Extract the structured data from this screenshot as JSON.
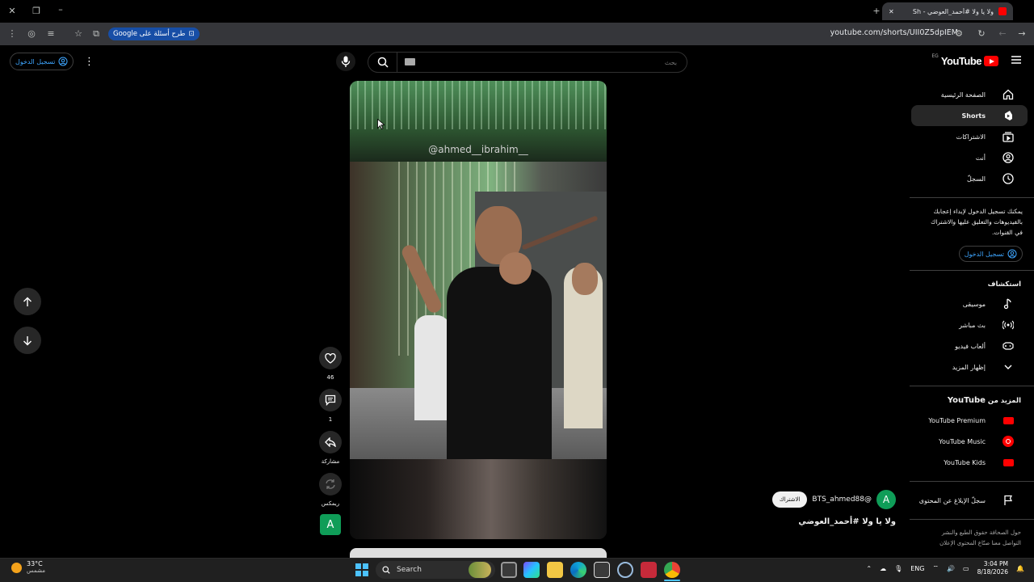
{
  "browser": {
    "tab_title": "ولا يا ولا #أحمد_العوضي - Sh",
    "url": "youtube.com/shorts/UII0Z5dpIEM",
    "google_chip": "طرح أسئلة على Google"
  },
  "header": {
    "signin": "تسجيل الدخول",
    "search_placeholder": "بحث",
    "logo_text": "YouTube",
    "country_code": "EG"
  },
  "sidebar": {
    "items": [
      {
        "label": "الصفحة الرئيسية",
        "icon": "home-icon"
      },
      {
        "label": "Shorts",
        "icon": "shorts-icon",
        "active": true
      },
      {
        "label": "الاشتراكات",
        "icon": "subscriptions-icon"
      },
      {
        "label": "أنت",
        "icon": "you-icon"
      },
      {
        "label": "السجلّ",
        "icon": "history-icon"
      }
    ],
    "signin_text": "يمكنك تسجيل الدخول لإبداء إعجابك بالفيديوهات والتعليق عليها والاشتراك في القنوات.",
    "signin_button": "تسجيل الدخول",
    "explore_title": "استكشاف",
    "explore": [
      {
        "label": "موسيقى",
        "icon": "music-icon"
      },
      {
        "label": "بث مباشر",
        "icon": "live-icon"
      },
      {
        "label": "ألعاب فيديو",
        "icon": "gaming-icon"
      },
      {
        "label": "إظهار المزيد",
        "icon": "chevron-down-icon"
      }
    ],
    "more_title_prefix": "المزيد من",
    "more_title_brand": "YouTube",
    "more": [
      {
        "label": "YouTube Premium"
      },
      {
        "label": "YouTube Music"
      },
      {
        "label": "YouTube Kids"
      }
    ],
    "report": "سجلّ الإبلاغ عن المحتوى",
    "footer_line1": "حول  الصحافة  حقوق الطبع والنشر",
    "footer_line2": "التواصل معنا  صنّاع المحتوى  الإعلان"
  },
  "short": {
    "watermark": "@ahmed__ibrahim__",
    "likes": "46",
    "comments": "1",
    "share": "مشاركة",
    "remix": "ريمكس",
    "channel_initial": "A",
    "channel_name": "@BTS_ahmed88",
    "subscribe": "الاشتراك",
    "title": "ولا يا ولا  #أحمد_العوضي"
  },
  "taskbar": {
    "temperature": "33°C",
    "condition": "مشمس",
    "search": "Search",
    "language": "ENG",
    "time": "3:04 PM",
    "date": "8/18/2026"
  }
}
